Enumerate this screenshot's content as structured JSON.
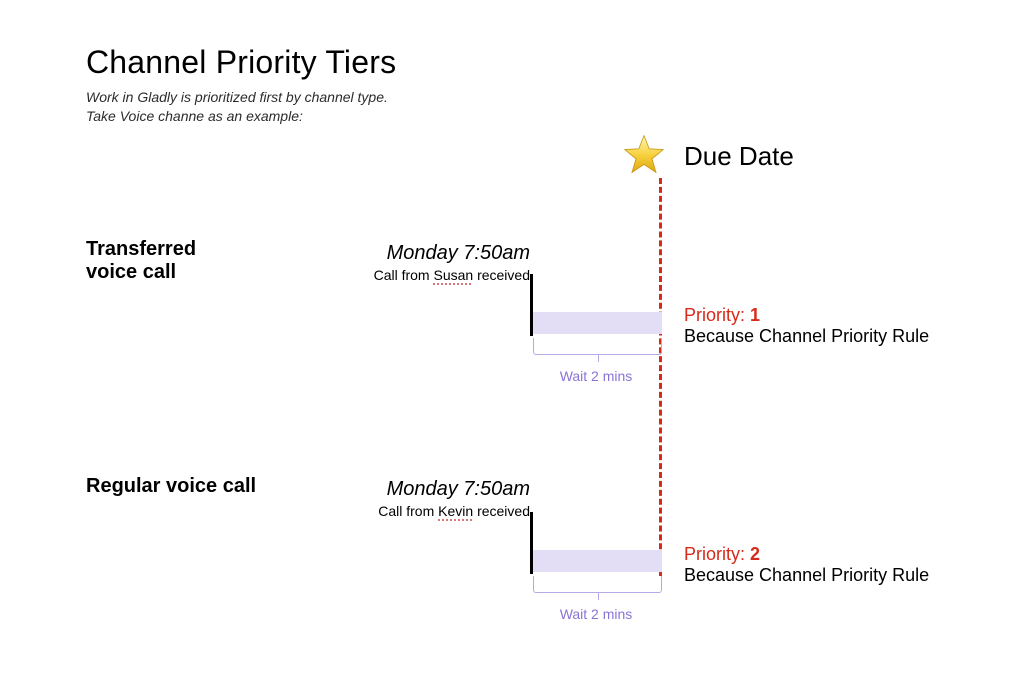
{
  "header": {
    "title": "Channel Priority Tiers",
    "subtitle": "Work in Gladly is prioritized first by channel type.\nTake Voice channe as an example:"
  },
  "due": {
    "label": "Due Date"
  },
  "rows": {
    "transferred": {
      "label": "Transferred\nvoice call",
      "timestamp": "Monday 7:50am",
      "caption_prefix": "Call from ",
      "caption_keyword": "Susan",
      "caption_suffix": " received",
      "wait_label": "Wait 2 mins",
      "priority_prefix": "Priority: ",
      "priority_value": "1",
      "priority_reason": "Because Channel Priority Rule"
    },
    "regular": {
      "label": "Regular voice call",
      "timestamp": "Monday 7:50am",
      "caption_prefix": "Call from ",
      "caption_keyword": "Kevin",
      "caption_suffix": " received",
      "wait_label": "Wait 2 mins",
      "priority_prefix": "Priority: ",
      "priority_value": "2",
      "priority_reason": "Because Channel Priority Rule"
    }
  }
}
